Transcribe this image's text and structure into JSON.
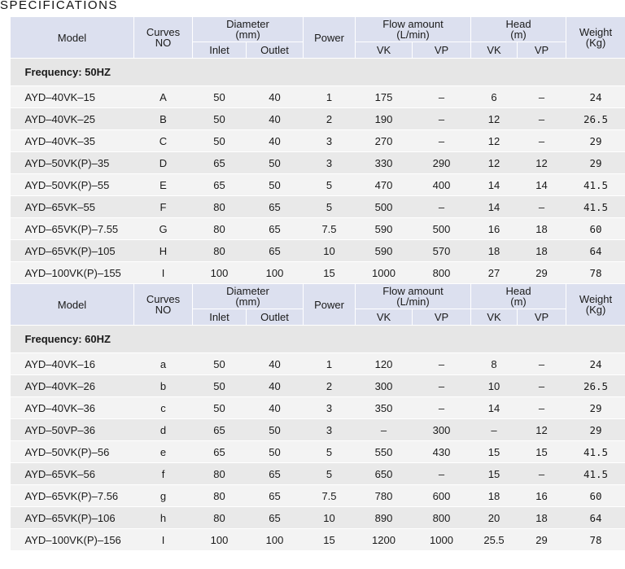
{
  "title": "SPECIFICATIONS",
  "header": {
    "model": "Model",
    "curves": [
      "Curves",
      "NO"
    ],
    "diameter": [
      "Diameter",
      "(mm)"
    ],
    "inlet": "Inlet",
    "outlet": "Outlet",
    "power": "Power",
    "flow": [
      "Flow amount",
      "(L/min)"
    ],
    "head": [
      "Head",
      "(m)"
    ],
    "vk": "VK",
    "vp": "VP",
    "weight": [
      "Weight",
      "(Kg)"
    ]
  },
  "sections": [
    {
      "frequency": "Frequency: 50HZ",
      "rows": [
        {
          "model": "AYD–40VK–15",
          "curve": "A",
          "inlet": "50",
          "outlet": "40",
          "power": "1",
          "flow_vk": "175",
          "flow_vp": "–",
          "head_vk": "6",
          "head_vp": "–",
          "weight": "24"
        },
        {
          "model": "AYD–40VK–25",
          "curve": "B",
          "inlet": "50",
          "outlet": "40",
          "power": "2",
          "flow_vk": "190",
          "flow_vp": "–",
          "head_vk": "12",
          "head_vp": "–",
          "weight": "26.5"
        },
        {
          "model": "AYD–40VK–35",
          "curve": "C",
          "inlet": "50",
          "outlet": "40",
          "power": "3",
          "flow_vk": "270",
          "flow_vp": "–",
          "head_vk": "12",
          "head_vp": "–",
          "weight": "29"
        },
        {
          "model": "AYD–50VK(P)–35",
          "curve": "D",
          "inlet": "65",
          "outlet": "50",
          "power": "3",
          "flow_vk": "330",
          "flow_vp": "290",
          "head_vk": "12",
          "head_vp": "12",
          "weight": "29"
        },
        {
          "model": "AYD–50VK(P)–55",
          "curve": "E",
          "inlet": "65",
          "outlet": "50",
          "power": "5",
          "flow_vk": "470",
          "flow_vp": "400",
          "head_vk": "14",
          "head_vp": "14",
          "weight": "41.5"
        },
        {
          "model": "AYD–65VK–55",
          "curve": "F",
          "inlet": "80",
          "outlet": "65",
          "power": "5",
          "flow_vk": "500",
          "flow_vp": "–",
          "head_vk": "14",
          "head_vp": "–",
          "weight": "41.5"
        },
        {
          "model": "AYD–65VK(P)–7.55",
          "curve": "G",
          "inlet": "80",
          "outlet": "65",
          "power": "7.5",
          "flow_vk": "590",
          "flow_vp": "500",
          "head_vk": "16",
          "head_vp": "18",
          "weight": "60"
        },
        {
          "model": "AYD–65VK(P)–105",
          "curve": "H",
          "inlet": "80",
          "outlet": "65",
          "power": "10",
          "flow_vk": "590",
          "flow_vp": "570",
          "head_vk": "18",
          "head_vp": "18",
          "weight": "64"
        },
        {
          "model": "AYD–100VK(P)–155",
          "curve": "I",
          "inlet": "100",
          "outlet": "100",
          "power": "15",
          "flow_vk": "1000",
          "flow_vp": "800",
          "head_vk": "27",
          "head_vp": "29",
          "weight": "78"
        }
      ]
    },
    {
      "frequency": "Frequency: 60HZ",
      "rows": [
        {
          "model": "AYD–40VK–16",
          "curve": "a",
          "inlet": "50",
          "outlet": "40",
          "power": "1",
          "flow_vk": "120",
          "flow_vp": "–",
          "head_vk": "8",
          "head_vp": "–",
          "weight": "24"
        },
        {
          "model": "AYD–40VK–26",
          "curve": "b",
          "inlet": "50",
          "outlet": "40",
          "power": "2",
          "flow_vk": "300",
          "flow_vp": "–",
          "head_vk": "10",
          "head_vp": "–",
          "weight": "26.5"
        },
        {
          "model": "AYD–40VK–36",
          "curve": "c",
          "inlet": "50",
          "outlet": "40",
          "power": "3",
          "flow_vk": "350",
          "flow_vp": "–",
          "head_vk": "14",
          "head_vp": "–",
          "weight": "29"
        },
        {
          "model": "AYD–50VP–36",
          "curve": "d",
          "inlet": "65",
          "outlet": "50",
          "power": "3",
          "flow_vk": "–",
          "flow_vp": "300",
          "head_vk": "–",
          "head_vp": "12",
          "weight": "29"
        },
        {
          "model": "AYD–50VK(P)–56",
          "curve": "e",
          "inlet": "65",
          "outlet": "50",
          "power": "5",
          "flow_vk": "550",
          "flow_vp": "430",
          "head_vk": "15",
          "head_vp": "15",
          "weight": "41.5"
        },
        {
          "model": "AYD–65VK–56",
          "curve": "f",
          "inlet": "80",
          "outlet": "65",
          "power": "5",
          "flow_vk": "650",
          "flow_vp": "–",
          "head_vk": "15",
          "head_vp": "–",
          "weight": "41.5"
        },
        {
          "model": "AYD–65VK(P)–7.56",
          "curve": "g",
          "inlet": "80",
          "outlet": "65",
          "power": "7.5",
          "flow_vk": "780",
          "flow_vp": "600",
          "head_vk": "18",
          "head_vp": "16",
          "weight": "60"
        },
        {
          "model": "AYD–65VK(P)–106",
          "curve": "h",
          "inlet": "80",
          "outlet": "65",
          "power": "10",
          "flow_vk": "890",
          "flow_vp": "800",
          "head_vk": "20",
          "head_vp": "18",
          "weight": "64"
        },
        {
          "model": "AYD–100VK(P)–156",
          "curve": "I",
          "inlet": "100",
          "outlet": "100",
          "power": "15",
          "flow_vk": "1200",
          "flow_vp": "1000",
          "head_vk": "25.5",
          "head_vp": "29",
          "weight": "78"
        }
      ]
    }
  ]
}
